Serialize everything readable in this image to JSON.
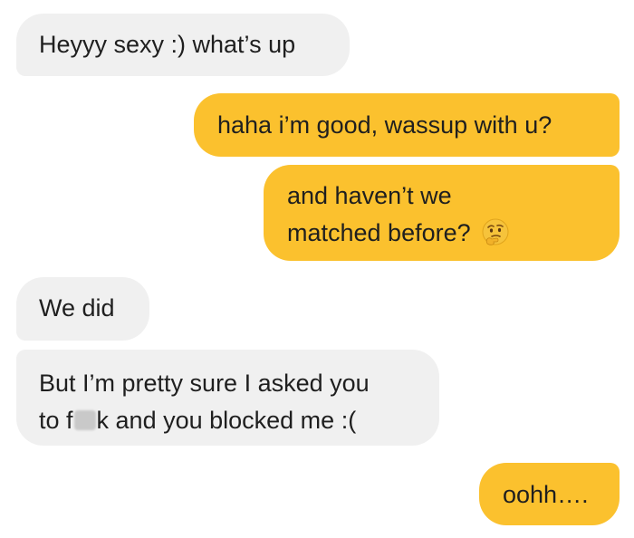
{
  "messages": [
    {
      "id": "m1",
      "direction": "incoming",
      "text": "Heyyy sexy :) what’s up"
    },
    {
      "id": "m2",
      "direction": "outgoing",
      "text": "haha i’m good, wassup with u?"
    },
    {
      "id": "m3",
      "direction": "outgoing",
      "line1": "and haven’t we",
      "line2": "matched before?",
      "emoji": "thinking-face-icon"
    },
    {
      "id": "m4",
      "direction": "incoming",
      "text": "We did"
    },
    {
      "id": "m5",
      "direction": "incoming",
      "line1": "But I’m pretty sure I asked you",
      "line2_start": "to f",
      "line2_end": "k and you blocked me :("
    },
    {
      "id": "m6",
      "direction": "outgoing",
      "text": "oohh…."
    }
  ],
  "colors": {
    "incoming_bubble": "#f0f0f0",
    "outgoing_bubble": "#fbc12e",
    "text": "#1f1f1f"
  }
}
